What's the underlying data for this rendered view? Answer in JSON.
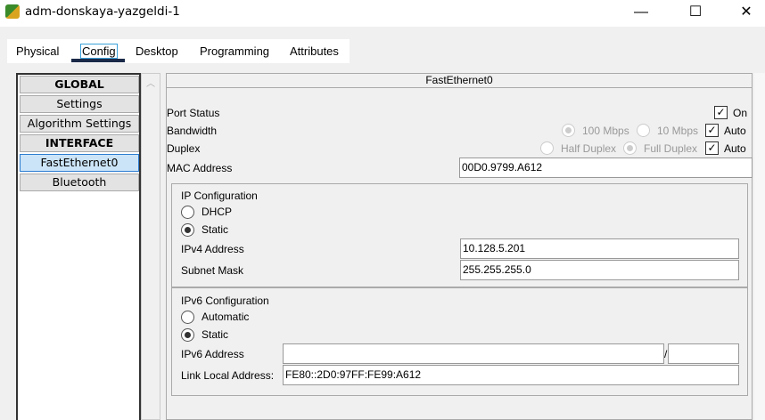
{
  "window": {
    "title": "adm-donskaya-yazgeldi-1",
    "minimize": "—",
    "maximize": "☐",
    "close": "✕"
  },
  "tabs": [
    "Physical",
    "Config",
    "Desktop",
    "Programming",
    "Attributes"
  ],
  "active_tab": "Config",
  "sidebar": {
    "items": [
      {
        "label": "GLOBAL",
        "header": true
      },
      {
        "label": "Settings"
      },
      {
        "label": "Algorithm Settings"
      },
      {
        "label": "INTERFACE",
        "header": true
      },
      {
        "label": "FastEthernet0",
        "selected": true
      },
      {
        "label": "Bluetooth"
      }
    ]
  },
  "panel": {
    "title": "FastEthernet0",
    "port_status": {
      "label": "Port Status",
      "on_label": "On",
      "checked": true
    },
    "bandwidth": {
      "label": "Bandwidth",
      "opt1": "100 Mbps",
      "opt2": "10 Mbps",
      "selected": "100 Mbps",
      "auto_label": "Auto",
      "auto": true
    },
    "duplex": {
      "label": "Duplex",
      "opt1": "Half Duplex",
      "opt2": "Full Duplex",
      "selected": "Full Duplex",
      "auto_label": "Auto",
      "auto": true
    },
    "mac": {
      "label": "MAC Address",
      "value": "00D0.9799.A612"
    },
    "ipv4": {
      "title": "IP Configuration",
      "dhcp": "DHCP",
      "static": "Static",
      "mode": "Static",
      "address_label": "IPv4 Address",
      "address": "10.128.5.201",
      "mask_label": "Subnet Mask",
      "mask": "255.255.255.0"
    },
    "ipv6": {
      "title": "IPv6 Configuration",
      "automatic": "Automatic",
      "static": "Static",
      "mode": "Static",
      "address_label": "IPv6 Address",
      "address": "",
      "slash": "/",
      "prefix": "",
      "link_local_label": "Link Local Address:",
      "link_local": "FE80::2D0:97FF:FE99:A612"
    }
  }
}
